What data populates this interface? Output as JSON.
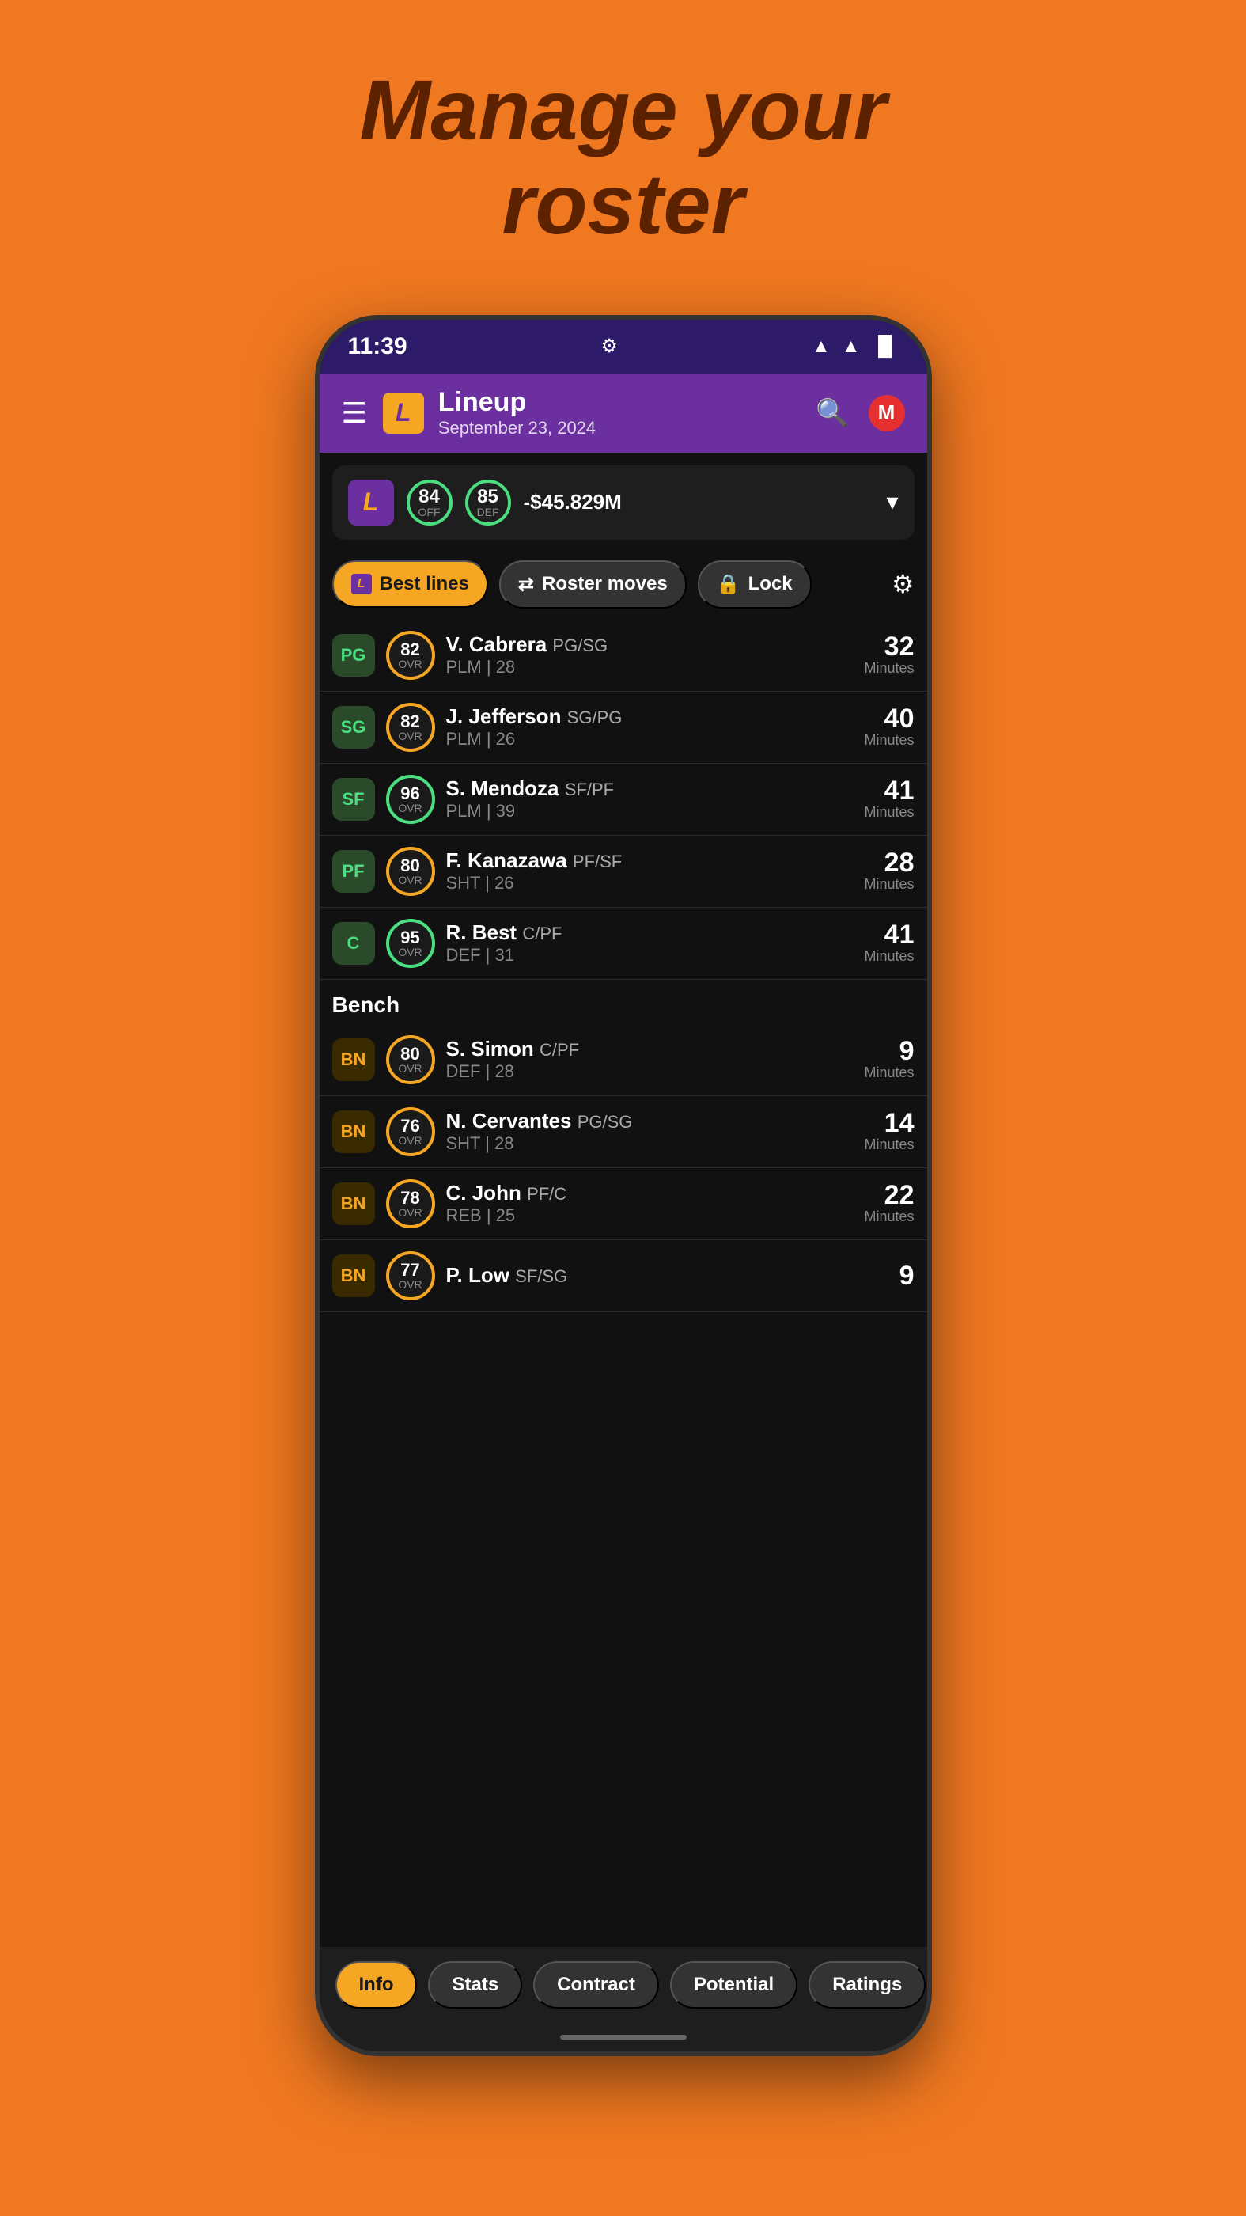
{
  "page": {
    "title_line1": "Manage your",
    "title_line2": "roster"
  },
  "status_bar": {
    "time": "11:39",
    "settings_icon": "⚙",
    "wifi_icon": "▲",
    "signal_icon": "▲",
    "battery_icon": "▐"
  },
  "header": {
    "menu_icon": "☰",
    "logo_text": "L",
    "title": "Lineup",
    "subtitle": "September 23, 2024",
    "search_icon": "🔍",
    "profile_letter": "M"
  },
  "team_summary": {
    "logo_text": "L",
    "off_rating": "84",
    "off_label": "OFF",
    "def_rating": "85",
    "def_label": "DEF",
    "budget": "-$45.829M",
    "chevron": "▾"
  },
  "action_bar": {
    "best_lines_label": "Best lines",
    "roster_moves_label": "Roster moves",
    "lock_label": "Lock",
    "gear_icon": "⚙"
  },
  "starters": [
    {
      "position": "PG",
      "ovr": "82",
      "ovr_color": "yellow",
      "name": "V. Cabrera",
      "pos_detail": "PG/SG",
      "meta": "PLM | 28",
      "minutes": "32"
    },
    {
      "position": "SG",
      "ovr": "82",
      "ovr_color": "yellow",
      "name": "J. Jefferson",
      "pos_detail": "SG/PG",
      "meta": "PLM | 26",
      "minutes": "40"
    },
    {
      "position": "SF",
      "ovr": "96",
      "ovr_color": "green",
      "name": "S. Mendoza",
      "pos_detail": "SF/PF",
      "meta": "PLM | 39",
      "minutes": "41"
    },
    {
      "position": "PF",
      "ovr": "80",
      "ovr_color": "yellow",
      "name": "F. Kanazawa",
      "pos_detail": "PF/SF",
      "meta": "SHT | 26",
      "minutes": "28"
    },
    {
      "position": "C",
      "ovr": "95",
      "ovr_color": "green",
      "name": "R. Best",
      "pos_detail": "C/PF",
      "meta": "DEF | 31",
      "minutes": "41"
    }
  ],
  "bench_label": "Bench",
  "bench": [
    {
      "position": "BN",
      "ovr": "80",
      "ovr_color": "yellow",
      "name": "S. Simon",
      "pos_detail": "C/PF",
      "meta": "DEF | 28",
      "minutes": "9"
    },
    {
      "position": "BN",
      "ovr": "76",
      "ovr_color": "yellow",
      "name": "N. Cervantes",
      "pos_detail": "PG/SG",
      "meta": "SHT | 28",
      "minutes": "14"
    },
    {
      "position": "BN",
      "ovr": "78",
      "ovr_color": "yellow",
      "name": "C. John",
      "pos_detail": "PF/C",
      "meta": "REB | 25",
      "minutes": "22"
    },
    {
      "position": "BN",
      "ovr": "77",
      "ovr_color": "yellow",
      "name": "P. Low",
      "pos_detail": "SF/SG",
      "meta": "",
      "minutes": "9"
    }
  ],
  "bottom_tabs": [
    {
      "label": "Info",
      "active": true
    },
    {
      "label": "Stats",
      "active": false
    },
    {
      "label": "Contract",
      "active": false
    },
    {
      "label": "Potential",
      "active": false
    },
    {
      "label": "Ratings",
      "active": false
    }
  ]
}
